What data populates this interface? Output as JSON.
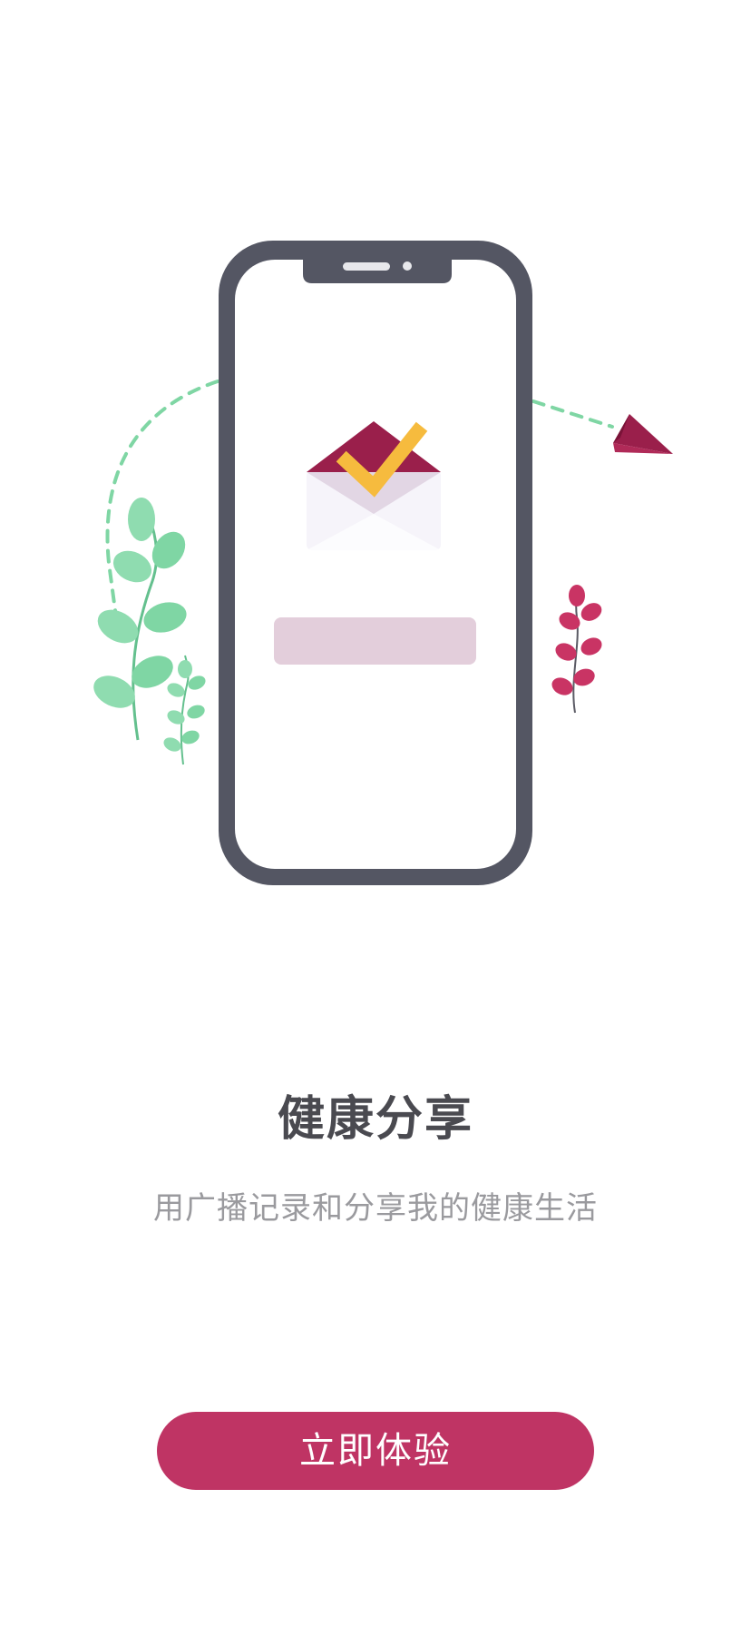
{
  "onboarding": {
    "title": "健康分享",
    "subtitle": "用广播记录和分享我的健康生活",
    "cta_label": "立即体验"
  },
  "illustration": {
    "icons": [
      "phone-frame",
      "envelope-check-icon",
      "paper-plane-icon",
      "green-leaf-branch",
      "red-leaf-branch"
    ],
    "colors": {
      "phone_frame": "#545663",
      "envelope_flap": "#9a1f4b",
      "check": "#f6bb3e",
      "progress_bar": "#e3cedb",
      "leaf_green": "#7fd6a4",
      "leaf_red": "#c93464",
      "dashed_path": "#7fd6a4"
    }
  },
  "theme": {
    "accent": "#bf3464",
    "title_color": "#4a4a50",
    "subtitle_color": "#9a9a9e"
  }
}
